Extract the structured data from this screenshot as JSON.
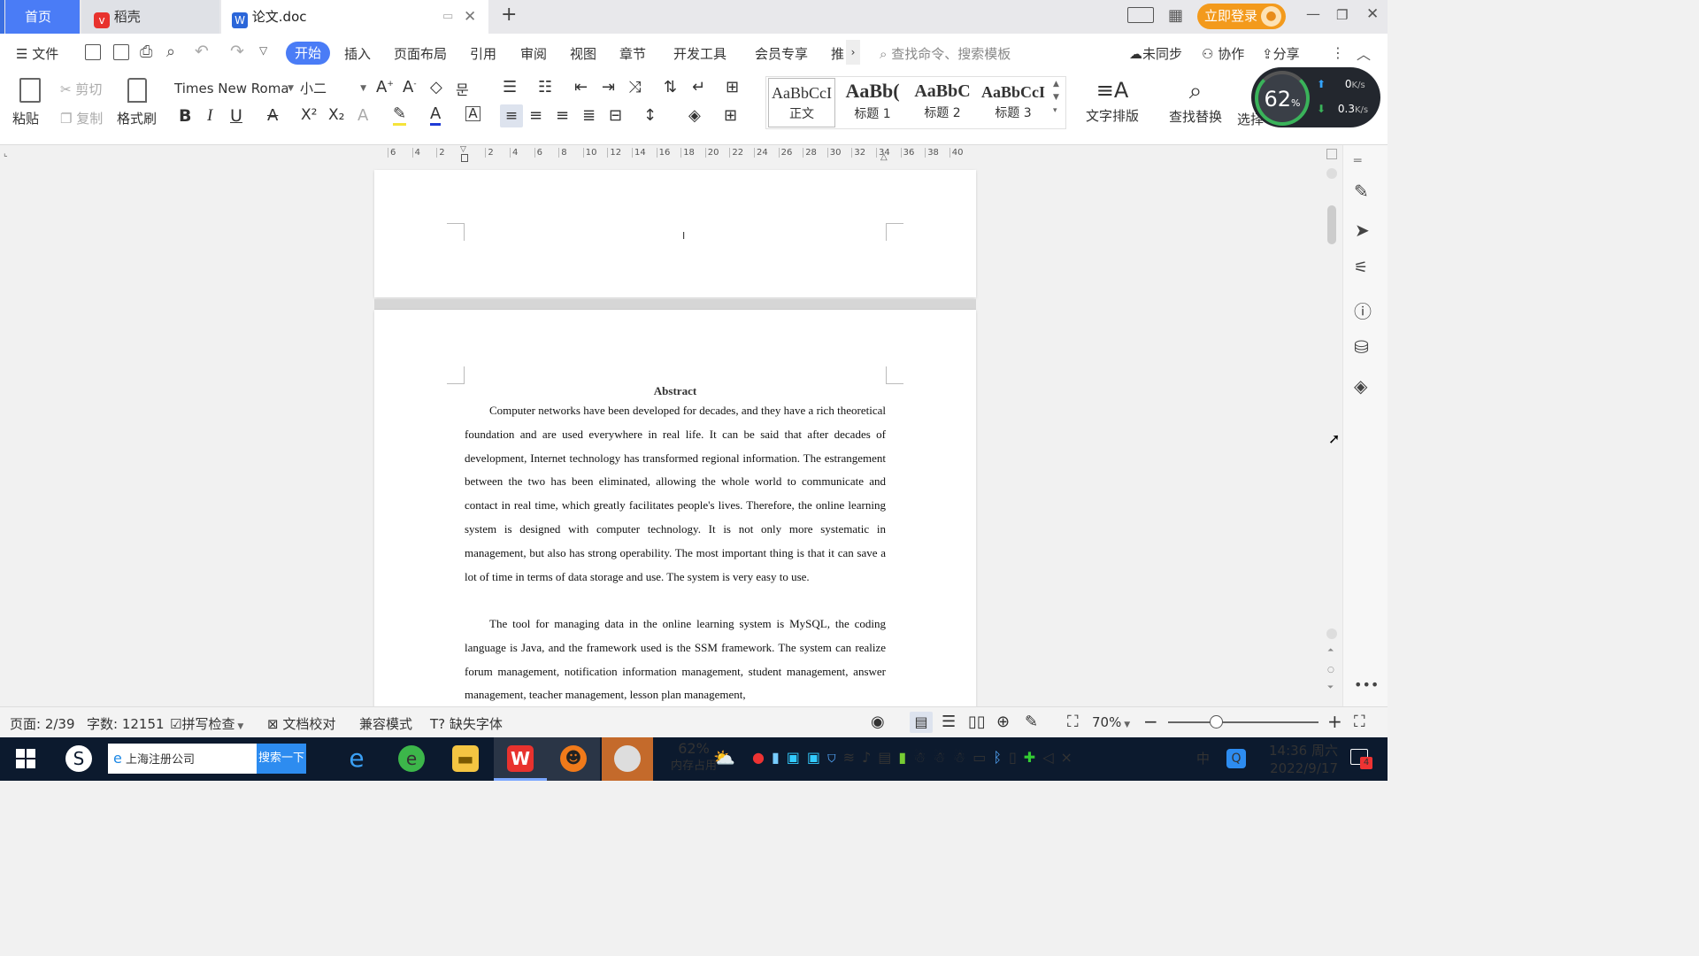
{
  "tabs": {
    "home": "首页",
    "daoke": "稻壳",
    "doc": "论文.doc",
    "new_tab": "+"
  },
  "title_right": {
    "login": "立即登录"
  },
  "menu": {
    "file": "文件",
    "items": [
      "开始",
      "插入",
      "页面布局",
      "引用",
      "审阅",
      "视图",
      "章节",
      "开发工具",
      "会员专享",
      "推"
    ],
    "search_placeholder": "查找命令、搜索模板",
    "sync": "未同步",
    "collab": "协作",
    "share": "分享"
  },
  "ribbon": {
    "paste": "粘贴",
    "cut": "剪切",
    "copy": "复制",
    "format_painter": "格式刷",
    "font_name": "Times New Roma",
    "font_size": "小二",
    "styles": [
      {
        "preview": "AaBbCcI",
        "label": "正文"
      },
      {
        "preview": "AaBb(",
        "label": "标题 1"
      },
      {
        "preview": "AaBbC",
        "label": "标题 2"
      },
      {
        "preview": "AaBbCcI",
        "label": "标题 3"
      }
    ],
    "text_layout": "文字排版",
    "find_replace": "查找替换",
    "select": "选择"
  },
  "speed_widget": {
    "percent": "62",
    "unit": "%",
    "up": "0",
    "up_unit": "K/s",
    "down": "0.3",
    "down_unit": "K/s"
  },
  "ruler": {
    "ticks": [
      "6",
      "4",
      "2",
      "",
      "2",
      "4",
      "6",
      "8",
      "10",
      "12",
      "14",
      "16",
      "18",
      "20",
      "22",
      "24",
      "26",
      "28",
      "30",
      "32",
      "34",
      "36",
      "38",
      "40"
    ]
  },
  "document": {
    "cursor": "I",
    "heading": "Abstract",
    "paragraphs": [
      "Computer networks have been developed for decades, and they have a rich theoretical foundation and are used everywhere in real life. It can be said that after decades of development, Internet technology has transformed regional information. The estrangement between the two has been eliminated, allowing the whole world to communicate and contact in real time, which greatly facilitates people's lives. Therefore, the online learning system is designed with computer technology. It is not only more systematic in management, but also has strong operability. The most important thing is that it can save a lot of time in terms of data storage and use. The system is very easy to use.",
      "The tool for managing data in the online learning system is MySQL, the coding language is Java, and the framework used is the SSM framework. The system can realize forum management, notification information management, student management, answer management, teacher management, lesson plan management,"
    ]
  },
  "status": {
    "page": "页面: 2/39",
    "words": "字数: 12151",
    "spell": "拼写检查",
    "proof": "文档校对",
    "compat": "兼容模式",
    "missing_font": "缺失字体",
    "zoom": "70%"
  },
  "taskbar": {
    "search_text": "上海注册公司",
    "search_button": "搜索一下",
    "mem_percent": "62%",
    "mem_label": "内存占用",
    "ime": "中",
    "time": "14:36 周六",
    "date": "2022/9/17",
    "notif_count": "4"
  },
  "colors": {
    "accent": "#4a7cf6",
    "login_orange": "#f39a1c",
    "taskbar": "#0c1a2e"
  }
}
